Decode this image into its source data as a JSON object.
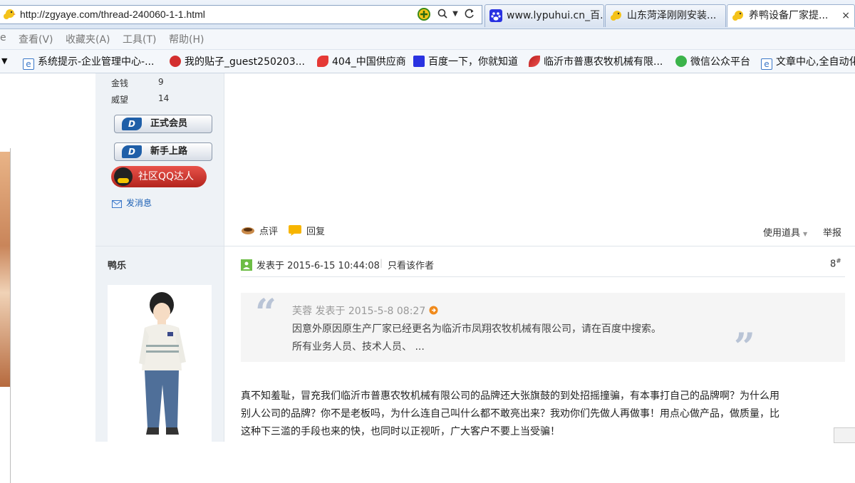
{
  "browser": {
    "url": "http://zgyaye.com/thread-240060-1-1.html",
    "tabs": [
      {
        "label": "www.lypuhui.cn_百...",
        "active": false
      },
      {
        "label": "山东菏泽刚刚安装...",
        "active": false
      },
      {
        "label": "养鸭设备厂家提...",
        "active": true
      }
    ],
    "close_glyph": "×",
    "menu": [
      "查看(V)",
      "收藏夹(A)",
      "工具(T)",
      "帮助(H)"
    ],
    "favorites": [
      {
        "label": "系统提示-企业管理中心-...",
        "icon": "ie-icon"
      },
      {
        "label": "我的贴子_guest250203...",
        "icon": "red-logo-icon"
      },
      {
        "label": "404_中国供应商",
        "icon": "red-logo-icon"
      },
      {
        "label": "百度一下，你就知道",
        "icon": "baidu-icon"
      },
      {
        "label": "临沂市普惠农牧机械有限...",
        "icon": "red-feather-icon"
      },
      {
        "label": "微信公众平台",
        "icon": "wechat-icon"
      },
      {
        "label": "文章中心,全自动化",
        "icon": "ie-icon"
      }
    ]
  },
  "profile": {
    "stats": [
      {
        "label": "金钱",
        "value": "9"
      },
      {
        "label": "威望",
        "value": "14"
      }
    ],
    "badges": [
      "正式会员",
      "新手上路"
    ],
    "qq_badge": "社区QQ达人",
    "message_link": "发消息",
    "next_username": "鸭乐"
  },
  "post_actions": {
    "rate": "点评",
    "reply": "回复",
    "use_tool": "使用道具",
    "report": "举报"
  },
  "post": {
    "posted_at": "发表于 2015-6-15 10:44:08",
    "only_author": "只看该作者",
    "floor": "8",
    "floor_mark": "#",
    "quote": {
      "header": "芙蓉 发表于 2015-5-8 08:27",
      "line1": "因意外原因原生产厂家已经更名为临沂市凤翔农牧机械有限公司，请在百度中搜索。",
      "line2": "所有业务人员、技术人员、 ..."
    },
    "body_lines": [
      "真不知羞耻，冒充我们临沂市普惠农牧机械有限公司的品牌还大张旗鼓的到处招摇撞骗，有本事打自己的品牌啊？为什么用",
      "别人公司的品牌？你不是老板吗，为什么连自己叫什么都不敢亮出来？我劝你们先做人再做事！用点心做产品，做质量，比",
      "这种下三滥的手段也来的快，也同时以正视听，广大客户不要上当受骗！"
    ]
  },
  "colors": {
    "accent": "#1f5fa8",
    "qq_red": "#c8342c",
    "sidebar_bg": "#eef2f6"
  }
}
